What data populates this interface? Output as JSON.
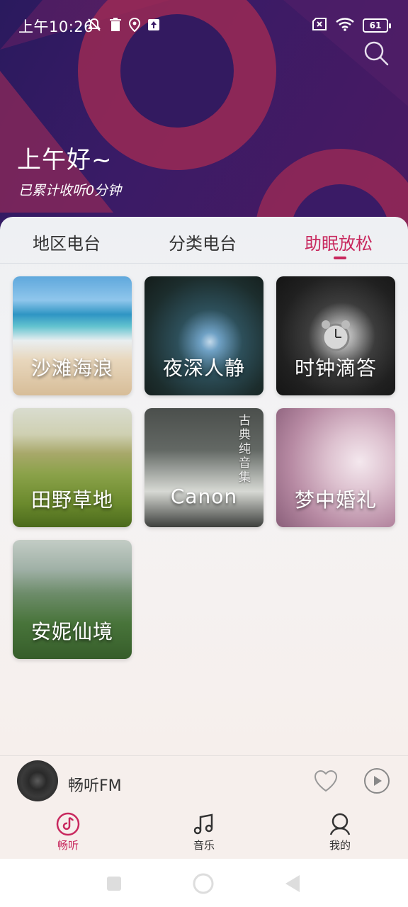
{
  "status_bar": {
    "time": "上午10:26",
    "battery": "61",
    "left_icons": [
      "notifications-off-icon",
      "trash-icon",
      "location-icon",
      "upload-icon"
    ],
    "right_icons": [
      "sim-off-icon",
      "wifi-icon",
      "battery-icon"
    ]
  },
  "header": {
    "greeting": "上午好~",
    "listen_stat": "已累计收听0分钟"
  },
  "tabs": [
    {
      "label": "地区电台",
      "active": false
    },
    {
      "label": "分类电台",
      "active": false
    },
    {
      "label": "助眠放松",
      "active": true
    }
  ],
  "cards": [
    {
      "label": "沙滩海浪"
    },
    {
      "label": "夜深人静"
    },
    {
      "label": "时钟滴答"
    },
    {
      "label": "田野草地"
    },
    {
      "label": "Canon",
      "subtitle": "古典纯音集"
    },
    {
      "label": "梦中婚礼"
    },
    {
      "label": "安妮仙境"
    }
  ],
  "player": {
    "title": "畅听FM"
  },
  "bottom_nav": [
    {
      "label": "畅听",
      "icon": "music-disc-icon",
      "active": true
    },
    {
      "label": "音乐",
      "icon": "music-note-icon",
      "active": false
    },
    {
      "label": "我的",
      "icon": "user-icon",
      "active": false
    }
  ],
  "colors": {
    "accent": "#c8285e",
    "header_bg": "#2a1a5e",
    "header_shape": "#8e2a5a"
  }
}
